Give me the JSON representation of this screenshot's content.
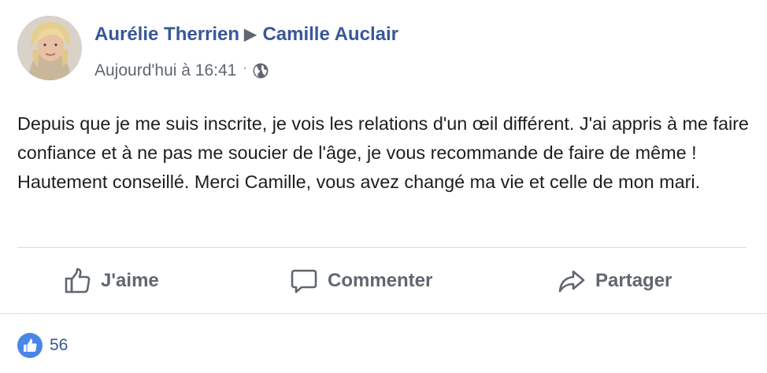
{
  "post": {
    "author": "Aurélie Therrien",
    "separator_icon": "triangle-right-icon",
    "recipient": "Camille Auclair",
    "timestamp": "Aujourd'hui à 16:41",
    "meta_separator": "·",
    "privacy_icon": "globe-icon",
    "text": "Depuis que je me suis inscrite, je vois les relations d'un œil différent. J'ai appris à me faire confiance et à ne pas me soucier de l'âge, je vous recommande de faire de même ! Hautement conseillé. Merci Camille, vous avez changé ma vie et celle de mon mari."
  },
  "actions": {
    "like": {
      "label": "J'aime",
      "icon": "thumbs-up-icon"
    },
    "comment": {
      "label": "Commenter",
      "icon": "comment-icon"
    },
    "share": {
      "label": "Partager",
      "icon": "share-icon"
    }
  },
  "reactions": {
    "icon": "like-reaction-icon",
    "count": "56"
  },
  "colors": {
    "link": "#385898",
    "secondary_text": "#606770",
    "like_badge": "#4a86e8",
    "divider": "#dadde1"
  }
}
